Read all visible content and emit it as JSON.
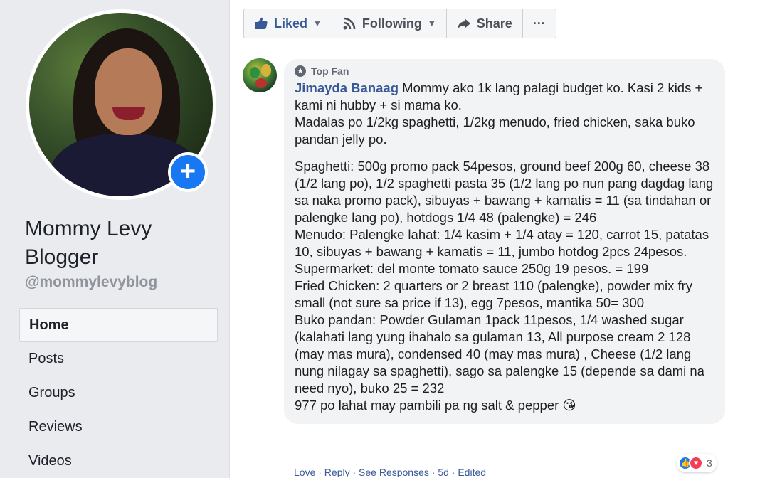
{
  "page": {
    "name": "Mommy Levy Blogger",
    "handle": "@mommylevyblog"
  },
  "nav": {
    "items": [
      {
        "label": "Home",
        "active": true
      },
      {
        "label": "Posts"
      },
      {
        "label": "Groups"
      },
      {
        "label": "Reviews"
      },
      {
        "label": "Videos"
      }
    ]
  },
  "actions": {
    "liked": "Liked",
    "following": "Following",
    "share": "Share",
    "more": "···"
  },
  "comment": {
    "badge": "Top Fan",
    "author": "Jimayda Banaag",
    "intro1": " Mommy ako 1k lang palagi budget ko. Kasi 2 kids + kami ni hubby + si mama ko.",
    "intro2": "Madalas po 1/2kg spaghetti, 1/2kg menudo, fried chicken, saka buko pandan jelly po.",
    "spaghetti": "Spaghetti: 500g promo pack 54pesos, ground beef 200g 60, cheese 38 (1/2 lang po), 1/2 spaghetti pasta 35 (1/2 lang po nun pang dagdag lang sa naka promo pack), sibuyas + bawang + kamatis = 11 (sa tindahan or palengke lang po), hotdogs 1/4 48 (palengke) = 246",
    "menudo": "Menudo: Palengke lahat: 1/4 kasim + 1/4 atay = 120, carrot 15, patatas 10, sibuyas + bawang + kamatis = 11, jumbo hotdog 2pcs 24pesos. Supermarket: del monte tomato sauce 250g 19 pesos. = 199",
    "chicken": "Fried Chicken: 2 quarters or 2 breast 110 (palengke), powder mix fry small (not sure sa price if 13), egg 7pesos, mantika 50= 300",
    "buko": "Buko pandan: Powder Gulaman 1pack 11pesos, 1/4 washed sugar (kalahati lang yung ihahalo sa gulaman 13, All purpose cream 2 128 (may mas mura), condensed 40 (may mas mura) , Cheese (1/2 lang nung nilagay sa spaghetti), sago sa palengke 15 (depende sa dami na need nyo), buko 25 = 232",
    "total": "977 po lahat may pambili pa ng salt & pepper 😘",
    "reaction_count": "3",
    "actions_line": "Love · Reply · See Responses · 5d · Edited"
  },
  "colors": {
    "brand": "#1877f2",
    "link": "#385898",
    "bubble": "#f2f3f5"
  }
}
